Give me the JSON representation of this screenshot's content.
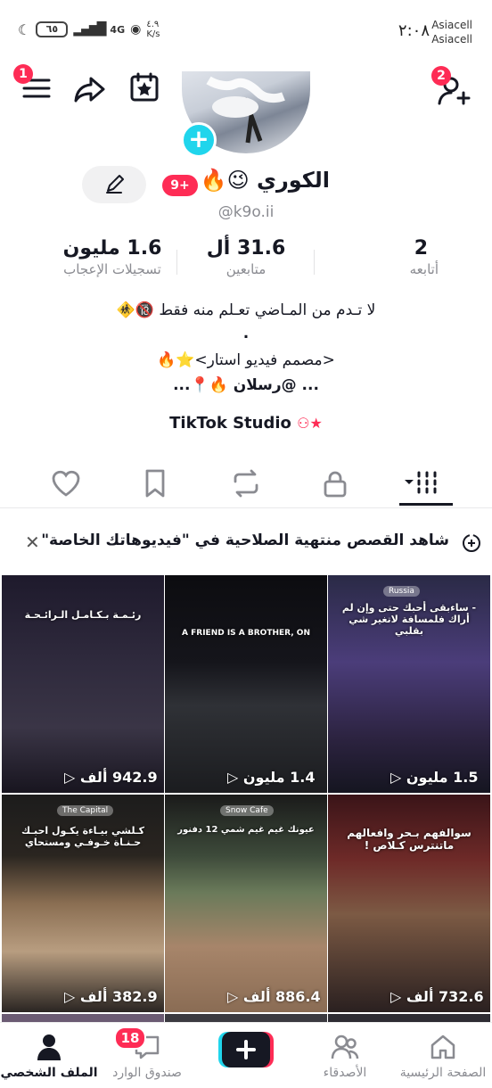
{
  "status_bar": {
    "time": "٢:٠٨",
    "carrier_1": "Asiacell",
    "carrier_2": "Asiacell",
    "battery": "٦٥",
    "speed_value": "٤.٩",
    "speed_unit": "K/s",
    "network": "4G"
  },
  "header": {
    "menu_badge": "1",
    "add_friends_badge": "2"
  },
  "profile": {
    "display_name": "الكوري 😉🔥",
    "level_badge": "9+",
    "username": "@k9o.ii",
    "stats": {
      "following_value": "2",
      "following_label": "أتابعه",
      "followers_value": "31.6 أل",
      "followers_label": "متابعين",
      "likes_value": "1.6 مليون",
      "likes_label": "تسجيلات الإعجاب"
    },
    "bio_line_1": "لا تـدم من المـاضي تعـلم منه فقط 🔞🚸",
    "bio_line_2": ".",
    "bio_line_3": "<مصمم فيديو استار>⭐🔥",
    "bio_line_4": "... @رسلان 🔥📍...",
    "studio_link": "TikTok Studio"
  },
  "story_bar": {
    "text": "شاهد القصص منتهية الصلاحية في \"فيديوهاتك الخاصة\""
  },
  "videos": [
    {
      "views": "1.5 مليون",
      "overlay": "- ساءبقى أحبك حتى وإن لم أراك فلمسافة لاتغير شي بقلبي",
      "location": "Russia"
    },
    {
      "views": "1.4 مليون",
      "overlay": "A FRIEND IS A BROTHER, ON",
      "location": ""
    },
    {
      "views": "942.9 ألف",
      "overlay": "رئـمـة بـكـامـل الـرائـحـة",
      "location": ""
    },
    {
      "views": "732.6 ألف",
      "overlay": "سوالفهم بـحر وافعالهم ماتنترس كـلاص !",
      "location": ""
    },
    {
      "views": "886.4 ألف",
      "overlay": "عيونك غيم غيم شمي 12 دفنور",
      "location": "Snow Cafe"
    },
    {
      "views": "382.9 ألف",
      "overlay": "كـلشي بيـاءة يكـول احبـك حـنـاة خـوفـي ومستحاي",
      "location": "The Capital"
    }
  ],
  "bottom_nav": {
    "home": "الصفحة الرئيسية",
    "friends": "الأصدقاء",
    "inbox": "صندوق الوارد",
    "inbox_badge": "18",
    "profile": "الملف الشخصي"
  },
  "colors": {
    "accent": "#fe2c55",
    "cyan": "#20d5ec",
    "text": "#161823",
    "muted": "#8a8b91"
  }
}
